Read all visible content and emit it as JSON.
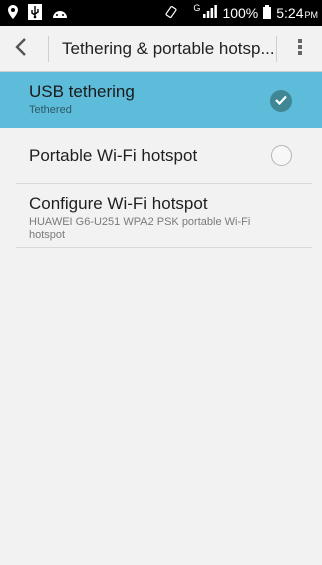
{
  "status_bar": {
    "icons": [
      "location-pin-icon",
      "usb-icon",
      "android-icon",
      "vibrate-icon",
      "signal-icon",
      "battery-icon"
    ],
    "signal_type": "G",
    "battery": "100%",
    "time": "5:24",
    "ampm": "PM"
  },
  "action_bar": {
    "title": "Tethering & portable hotsp..."
  },
  "settings": {
    "usb": {
      "title": "USB tethering",
      "summary": "Tethered",
      "checked": true
    },
    "wifi_hotspot": {
      "title": "Portable Wi-Fi hotspot",
      "checked": false
    },
    "configure": {
      "title": "Configure Wi-Fi hotspot",
      "summary": "HUAWEI G6-U251 WPA2 PSK portable Wi-Fi hotspot"
    }
  },
  "colors": {
    "status_bar": "#000000",
    "selected_row": "#5dbcd9",
    "check_fill": "#3f8794",
    "background": "#f2f2f2"
  }
}
